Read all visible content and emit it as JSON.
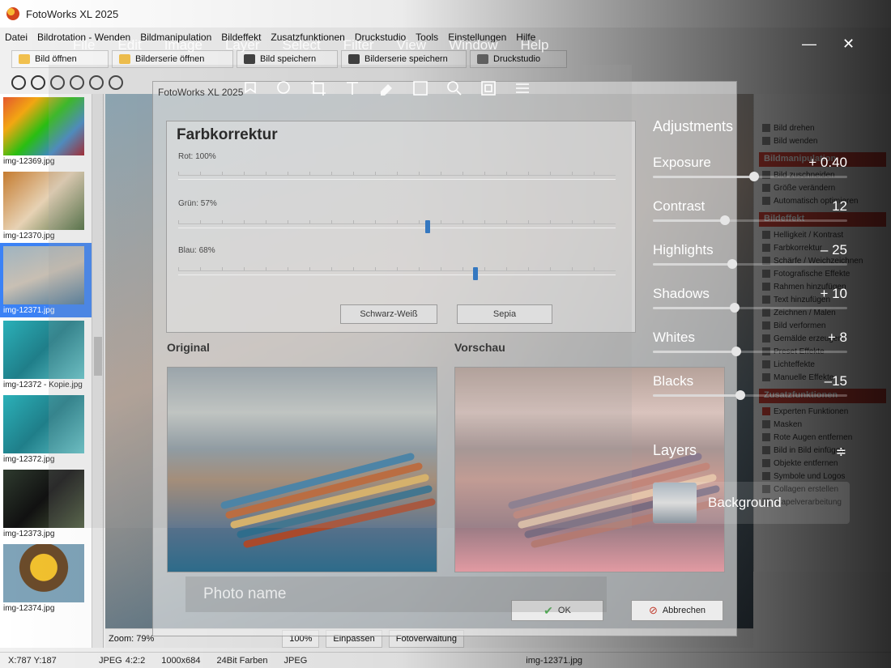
{
  "app": {
    "title": "FotoWorks XL 2025",
    "menu": [
      "Datei",
      "Bildrotation - Wenden",
      "Bildmanipulation",
      "Bildeffekt",
      "Zusatzfunktionen",
      "Druckstudio",
      "Tools",
      "Einstellungen",
      "Hilfe"
    ],
    "toolbar": {
      "open_image": "Bild öffnen",
      "open_series": "Bilderserie öffnen",
      "save_image": "Bild speichern",
      "save_series": "Bilderserie speichern",
      "print_studio": "Druckstudio"
    },
    "thumbnails": [
      {
        "name": "img-12369.jpg",
        "selected": false
      },
      {
        "name": "img-12370.jpg",
        "selected": false
      },
      {
        "name": "img-12371.jpg",
        "selected": true
      },
      {
        "name": "img-12372 - Kopie.jpg",
        "selected": false
      },
      {
        "name": "img-12372.jpg",
        "selected": false
      },
      {
        "name": "img-12373.jpg",
        "selected": false
      },
      {
        "name": "img-12374.jpg",
        "selected": false
      }
    ],
    "zoom": {
      "label": "Zoom: 79%",
      "btn_100": "100%",
      "btn_fit": "Einpassen",
      "btn_manage": "Fotoverwaltung"
    },
    "status": {
      "coords": "X:787 Y:187",
      "format": "JPEG",
      "sampling": "4:2:2",
      "size": "1000x684",
      "depth": "24Bit Farben",
      "type": "JPEG",
      "file": "img-12371.jpg"
    },
    "right_panel": {
      "sections": [
        {
          "head": "",
          "items": [
            "Bild drehen",
            "Bild wenden"
          ]
        },
        {
          "head": "Bildmanipulation",
          "items": [
            "Bild zuschneiden",
            "Größe verändern",
            "Automatisch optimieren"
          ]
        },
        {
          "head": "Bildeffekt",
          "items": [
            "Helligkeit / Kontrast",
            "Farbkorrektur",
            "Schärfe / Weichzeichnen",
            "Fotografische Effekte",
            "Rahmen hinzufügen",
            "Text hinzufügen",
            "Zeichnen / Malen",
            "Bild verformen",
            "Gemälde erzeugen",
            "Preset Effekte",
            "Lichteffekte",
            "Manuelle Effekte"
          ]
        },
        {
          "head": "Zusatzfunktionen",
          "items": [
            "Experten Funktionen",
            "Masken",
            "Rote Augen entfernen",
            "Bild in Bild einfügen",
            "Objekte entfernen",
            "Symbole und Logos",
            "Collagen erstellen",
            "Stapelverarbeitung"
          ]
        }
      ]
    }
  },
  "dialog": {
    "title": "FotoWorks XL 2025",
    "heading": "Farbkorrektur",
    "sliders": [
      {
        "label": "Rot: 100%",
        "value": 1.0
      },
      {
        "label": "Grün: 57%",
        "value": 0.57
      },
      {
        "label": "Blau: 68%",
        "value": 0.68
      }
    ],
    "btn_bw": "Schwarz-Weiß",
    "btn_sepia": "Sepia",
    "label_original": "Original",
    "label_preview": "Vorschau",
    "ok": "OK",
    "cancel": "Abbrechen"
  },
  "overlay": {
    "menu": [
      "File",
      "Edit",
      "Image",
      "Layer",
      "Select",
      "Filter",
      "View",
      "Window",
      "Help"
    ],
    "window_controls": {
      "minimize": "—",
      "close": "✕"
    },
    "adjustments_title": "Adjustments",
    "adjustments": [
      {
        "name": "Exposure",
        "value": "+ 0.40",
        "level": 0.52
      },
      {
        "name": "Contrast",
        "value": "12",
        "level": 0.37
      },
      {
        "name": "Highlights",
        "value": "– 25",
        "level": 0.41
      },
      {
        "name": "Shadows",
        "value": "+ 10",
        "level": 0.42
      },
      {
        "name": "Whites",
        "value": "+ 8",
        "level": 0.43
      },
      {
        "name": "Blacks",
        "value": "–15",
        "level": 0.45
      }
    ],
    "layers_title": "Layers",
    "layers_menu_icon": "≑",
    "layer_name": "Background",
    "photo_name_placeholder": "Photo name"
  }
}
